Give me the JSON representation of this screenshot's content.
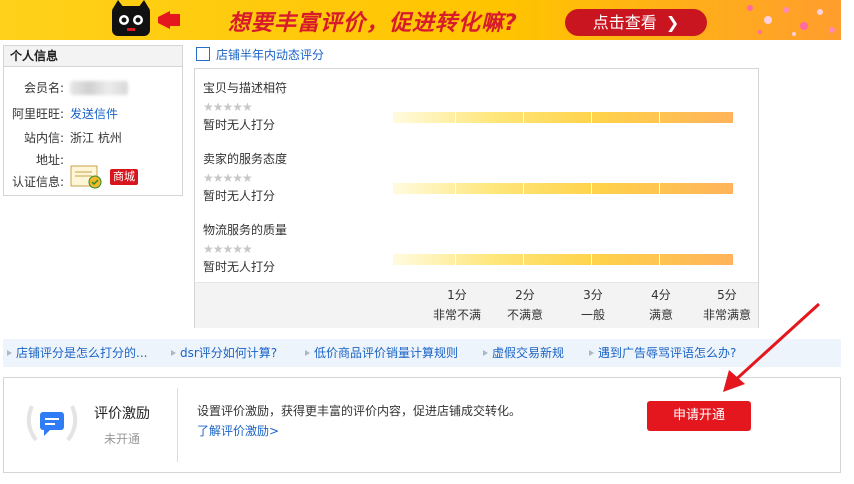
{
  "banner": {
    "headline": "想要丰富评价，促进转化嘛?",
    "cta_label": "点击查看"
  },
  "profile": {
    "title": "个人信息",
    "member_label": "会员名:",
    "wangwang_label": "阿里旺旺:",
    "wangwang_link": "发送信件",
    "site_label": "站内信:",
    "site_value": "浙江   杭州",
    "address_label": "地址:",
    "cert_label": "认证信息:",
    "mall_badge": "商城"
  },
  "rating_section": {
    "title": "店铺半年内动态评分",
    "items": [
      {
        "name": "宝贝与描述相符",
        "stars": "★★★★★",
        "status": "暂时无人打分"
      },
      {
        "name": "卖家的服务态度",
        "stars": "★★★★★",
        "status": "暂时无人打分"
      },
      {
        "name": "物流服务的质量",
        "stars": "★★★★★",
        "status": "暂时无人打分"
      }
    ],
    "scale": [
      {
        "score": "1分",
        "desc": "非常不满"
      },
      {
        "score": "2分",
        "desc": "不满意"
      },
      {
        "score": "3分",
        "desc": "一般"
      },
      {
        "score": "4分",
        "desc": "满意"
      },
      {
        "score": "5分",
        "desc": "非常满意"
      }
    ]
  },
  "help_links": [
    "店铺评分是怎么打分的...",
    "dsr评分如何计算?",
    "低价商品评价销量计算规则",
    "虚假交易新规",
    "遇到广告辱骂评语怎么办?"
  ],
  "incentive": {
    "title": "评价激励",
    "status": "未开通",
    "description": "设置评价激励，获得更丰富的评价内容，促进店铺成交转化。",
    "learn_more": "了解评价激励>",
    "apply_label": "申请开通"
  },
  "colors": {
    "accent_red": "#e4161e",
    "link_blue": "#1a63c5",
    "banner_yellow": "#ffc400"
  }
}
